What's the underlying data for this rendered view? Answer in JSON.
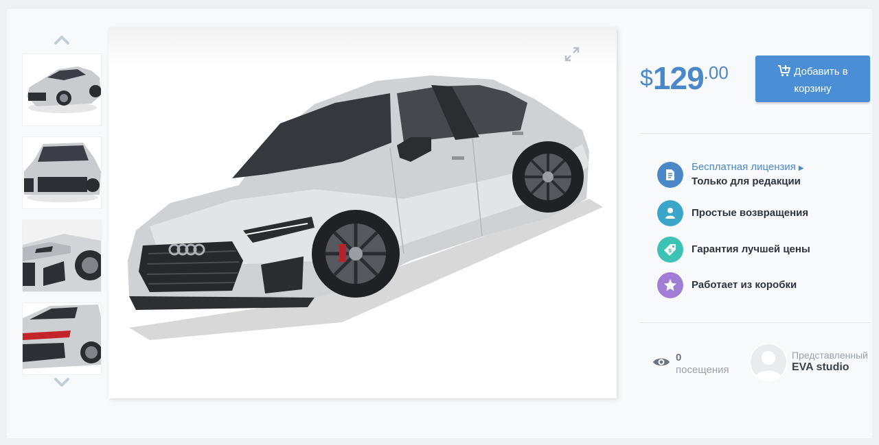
{
  "product": {
    "price": {
      "currency": "$",
      "integer": "129",
      "decimal": ".00"
    },
    "cart_button_label_line1": "Добавить в",
    "cart_button_label_line2": "корзину"
  },
  "features": [
    {
      "icon": "document-icon",
      "link": "Бесплатная лицензия",
      "title": "Только для редакции",
      "color": "#4b88c8"
    },
    {
      "icon": "user-return-icon",
      "title": "Простые возвращения",
      "color": "#3aa6c9"
    },
    {
      "icon": "price-tag-icon",
      "title": "Гарантия лучшей цены",
      "color": "#3cc3b4"
    },
    {
      "icon": "star-icon",
      "title": "Работает из коробки",
      "color": "#a17ed6"
    }
  ],
  "stats": {
    "visits_count": "0",
    "visits_label": "посещения"
  },
  "author": {
    "presented_label": "Представленный",
    "name": "EVA studio"
  },
  "gallery": {
    "thumbnails": [
      "front-three-quarter",
      "front",
      "front-closeup",
      "rear"
    ],
    "selected": 0
  }
}
